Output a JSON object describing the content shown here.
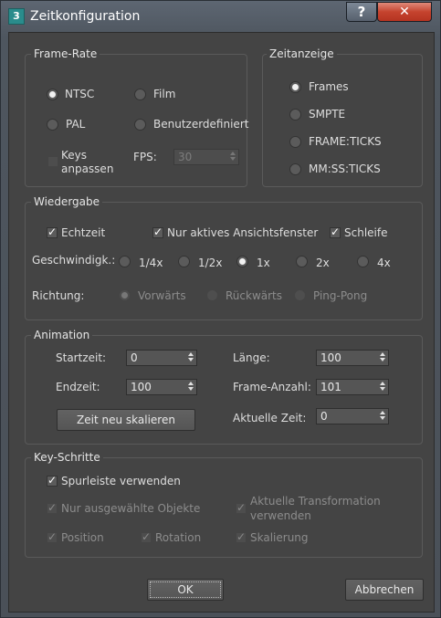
{
  "window": {
    "title": "Zeitkonfiguration",
    "app_icon_text": "3"
  },
  "frame_rate": {
    "title": "Frame-Rate",
    "ntsc": "NTSC",
    "film": "Film",
    "pal": "PAL",
    "custom": "Benutzerdefiniert",
    "keys_line1": "Keys",
    "keys_line2": "anpassen",
    "fps_label": "FPS:",
    "fps_value": "30",
    "selected": "NTSC"
  },
  "time_display": {
    "title": "Zeitanzeige",
    "frames": "Frames",
    "smpte": "SMPTE",
    "frame_ticks": "FRAME:TICKS",
    "mm_ss_ticks": "MM:SS:TICKS",
    "selected": "Frames"
  },
  "playback": {
    "title": "Wiedergabe",
    "realtime": "Echtzeit",
    "active_viewport": "Nur aktives Ansichtsfenster",
    "loop": "Schleife",
    "speed_label": "Geschwindigk.:",
    "speeds": [
      "1/4x",
      "1/2x",
      "1x",
      "2x",
      "4x"
    ],
    "speed_selected": "1x",
    "direction_label": "Richtung:",
    "directions": [
      "Vorwärts",
      "Rückwärts",
      "Ping-Pong"
    ],
    "direction_selected": "Vorwärts"
  },
  "animation": {
    "title": "Animation",
    "start_label": "Startzeit:",
    "start_value": "0",
    "end_label": "Endzeit:",
    "end_value": "100",
    "length_label": "Länge:",
    "length_value": "100",
    "frame_count_label": "Frame-Anzahl:",
    "frame_count_value": "101",
    "current_label": "Aktuelle Zeit:",
    "current_value": "0",
    "rescale_button": "Zeit neu skalieren"
  },
  "key_steps": {
    "title": "Key-Schritte",
    "use_trackbar": "Spurleiste verwenden",
    "selected_only": "Nur ausgewählte Objekte",
    "current_transform_line1": "Aktuelle Transformation",
    "current_transform_line2": "verwenden",
    "position": "Position",
    "rotation": "Rotation",
    "scale": "Skalierung"
  },
  "buttons": {
    "ok": "OK",
    "cancel": "Abbrechen"
  }
}
